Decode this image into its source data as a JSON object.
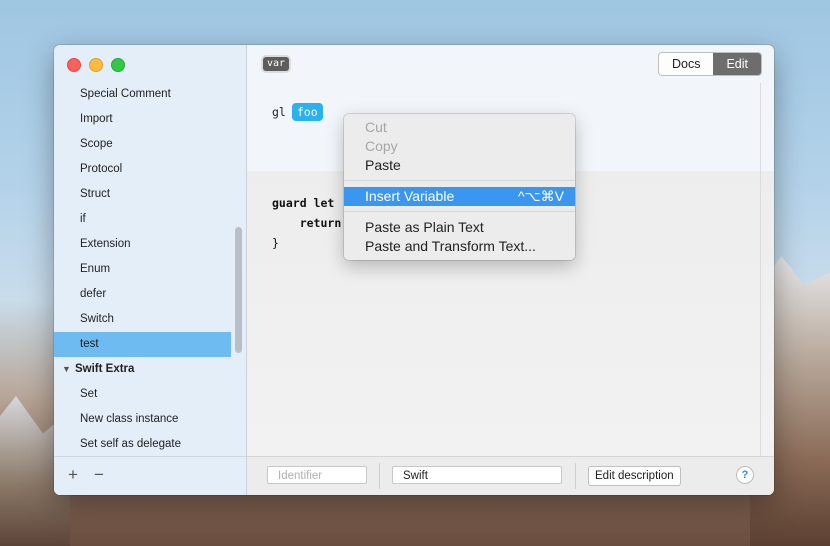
{
  "sidebar": {
    "items": [
      {
        "label": "Special Comment"
      },
      {
        "label": "Import"
      },
      {
        "label": "Scope"
      },
      {
        "label": "Protocol"
      },
      {
        "label": "Struct"
      },
      {
        "label": "if"
      },
      {
        "label": "Extension"
      },
      {
        "label": "Enum"
      },
      {
        "label": "defer"
      },
      {
        "label": "Switch"
      },
      {
        "label": "test"
      }
    ],
    "group": {
      "label": "Swift Extra",
      "disclosure": "▼"
    },
    "group_items": [
      {
        "label": "Set"
      },
      {
        "label": "New class instance"
      },
      {
        "label": "Set self as delegate"
      }
    ],
    "add_label": "+",
    "remove_label": "−"
  },
  "toolbar": {
    "var_token": "var",
    "docs_label": "Docs",
    "edit_label": "Edit"
  },
  "abbreviation": {
    "prefix": "gl",
    "token": "foo"
  },
  "code": {
    "line1": "guard let",
    "line2": "return",
    "line3": "}"
  },
  "bottom": {
    "identifier_placeholder": "Identifier",
    "language_value": "Swift",
    "edit_description_label": "Edit description",
    "help_label": "?"
  },
  "context_menu": {
    "cut": "Cut",
    "copy": "Copy",
    "paste": "Paste",
    "insert_variable": "Insert Variable",
    "insert_variable_shortcut": "^⌥⌘V",
    "paste_plain": "Paste as Plain Text",
    "paste_transform": "Paste and Transform Text..."
  },
  "colors": {
    "selection": "#6ebbf1",
    "token_blue": "#2ab2ee",
    "menu_highlight": "#3b96ef"
  }
}
